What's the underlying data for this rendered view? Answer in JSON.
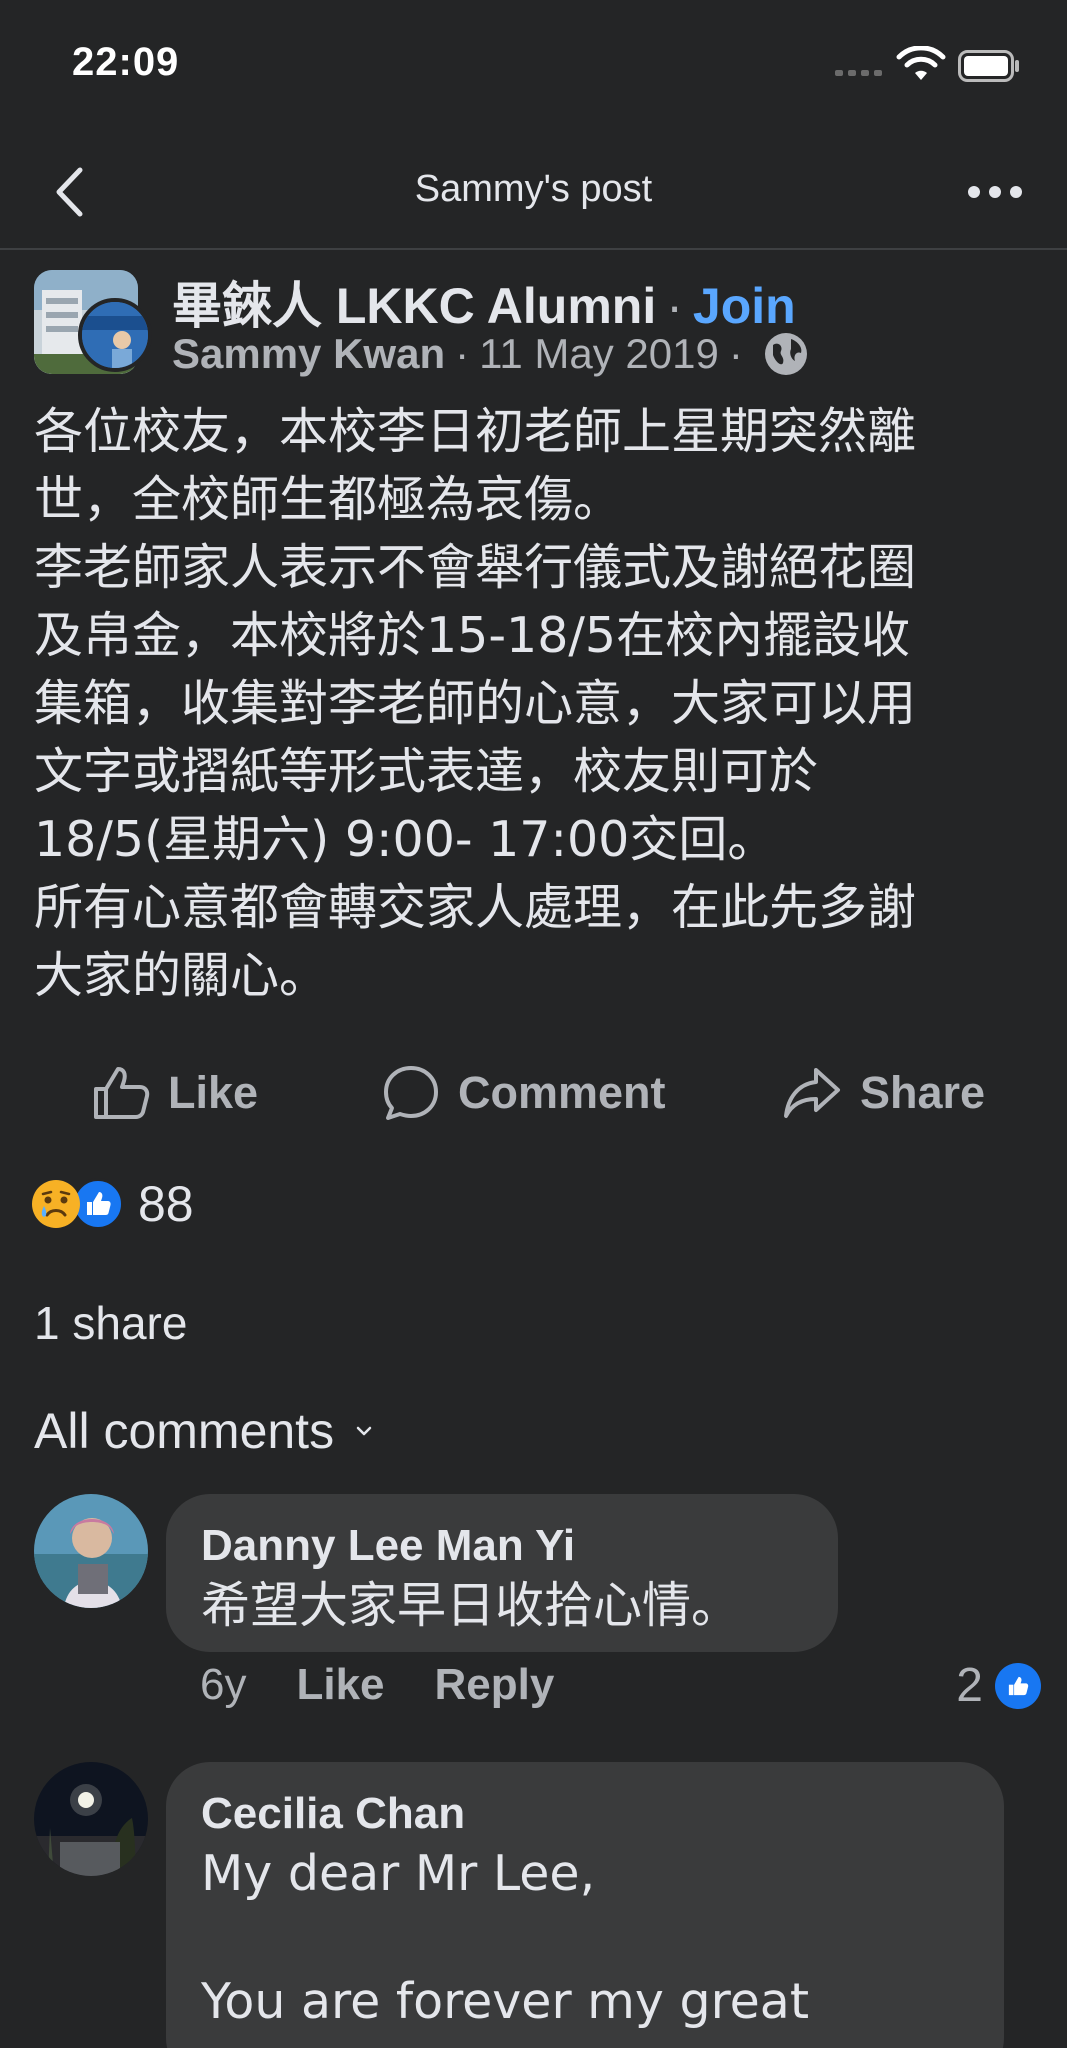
{
  "status_bar": {
    "time": "22:09"
  },
  "nav": {
    "title": "Sammy's post"
  },
  "post": {
    "group_name": "畢錸人 LKKC Alumni",
    "separator": "·",
    "join_label": "Join",
    "author": "Sammy Kwan",
    "date": "11 May 2019",
    "body_lines": [
      "各位校友，本校李日初老師上星期突然離",
      "世，全校師生都極為哀傷。",
      "李老師家人表示不會舉行儀式及謝絕花圈",
      "及帛金，本校將於15-18/5在校內擺設收",
      "集箱，收集對李老師的心意，大家可以用",
      "文字或摺紙等形式表達，校友則可於",
      "18/5(星期六) 9:00- 17:00交回。",
      "所有心意都會轉交家人處理，在此先多謝",
      "大家的關心。"
    ]
  },
  "actions": {
    "like": "Like",
    "comment": "Comment",
    "share": "Share"
  },
  "reactions": {
    "count": "88",
    "icons": [
      "sad-reaction-icon",
      "like-reaction-icon"
    ]
  },
  "shares": {
    "label": "1 share"
  },
  "comments_filter": {
    "label": "All comments"
  },
  "comments": [
    {
      "name": "Danny Lee Man Yi",
      "text": "希望大家早日收拾心情。",
      "age": "6y",
      "like_label": "Like",
      "reply_label": "Reply",
      "likes": "2"
    },
    {
      "name": "Cecilia Chan",
      "text": "My dear Mr Lee,\n\nYou are forever my great"
    }
  ],
  "colors": {
    "background": "#242526",
    "bubble": "#3a3b3c",
    "text_primary": "#e4e6eb",
    "text_secondary": "#b0b3b8",
    "accent_blue": "#5aa7ff",
    "like_blue": "#1877f2",
    "sad_yellow": "#f7b125"
  }
}
